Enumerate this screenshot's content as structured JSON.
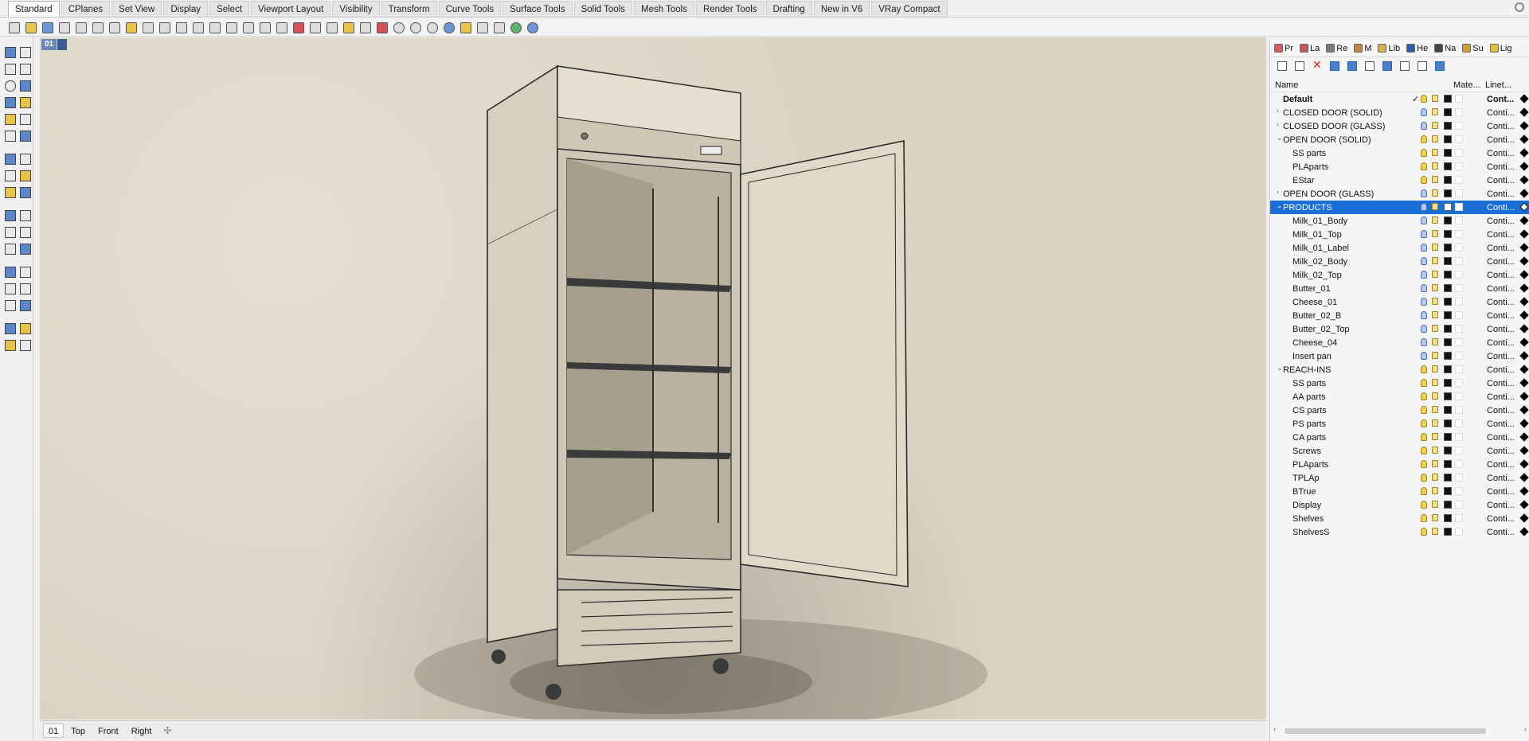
{
  "ribbon_tabs": [
    "Standard",
    "CPlanes",
    "Set View",
    "Display",
    "Select",
    "Viewport Layout",
    "Visibility",
    "Transform",
    "Curve Tools",
    "Surface Tools",
    "Solid Tools",
    "Mesh Tools",
    "Render Tools",
    "Drafting",
    "New in V6",
    "VRay Compact"
  ],
  "active_tab": "Standard",
  "viewport": {
    "name": "01",
    "tabs": [
      "01",
      "Top",
      "Front",
      "Right"
    ],
    "active_tab": "01",
    "add_tab_glyph": "✣"
  },
  "panel": {
    "tabs": [
      {
        "label": "Pr",
        "icon": "properties-icon",
        "color": "#d95b5b"
      },
      {
        "label": "La",
        "icon": "layers-icon",
        "color": "#c65a5a"
      },
      {
        "label": "Re",
        "icon": "render-icon",
        "color": "#7a7a7a"
      },
      {
        "label": "M",
        "icon": "material-icon",
        "color": "#c9873c"
      },
      {
        "label": "Lib",
        "icon": "library-icon",
        "color": "#d6b14a"
      },
      {
        "label": "He",
        "icon": "help-icon",
        "color": "#2b5fa9"
      },
      {
        "label": "Na",
        "icon": "named-views-icon",
        "color": "#444444"
      },
      {
        "label": "Su",
        "icon": "sun-icon",
        "color": "#d6a12e"
      },
      {
        "label": "Lig",
        "icon": "lights-icon",
        "color": "#e0c040"
      }
    ],
    "columns": {
      "name": "Name",
      "material": "Mate...",
      "linetype": "Linet..."
    },
    "selected_color": "#1a6fd6",
    "layers": [
      {
        "name": "Default",
        "level": 0,
        "expander": "",
        "current": true,
        "bulb": "yellow",
        "bold": true,
        "linetype": "Cont..."
      },
      {
        "name": "CLOSED DOOR (SOLID)",
        "level": 0,
        "expander": "›",
        "bulb": "blue",
        "linetype": "Conti..."
      },
      {
        "name": "CLOSED DOOR (GLASS)",
        "level": 0,
        "expander": "›",
        "bulb": "blue",
        "linetype": "Conti..."
      },
      {
        "name": "OPEN DOOR (SOLID)",
        "level": 0,
        "expander": "⌄",
        "bulb": "yellow",
        "linetype": "Conti..."
      },
      {
        "name": "SS parts",
        "level": 1,
        "bulb": "yellow",
        "linetype": "Conti..."
      },
      {
        "name": "PLAparts",
        "level": 1,
        "bulb": "yellow",
        "linetype": "Conti..."
      },
      {
        "name": "EStar",
        "level": 1,
        "bulb": "yellow",
        "linetype": "Conti..."
      },
      {
        "name": "OPEN DOOR (GLASS)",
        "level": 0,
        "expander": "›",
        "bulb": "blue",
        "linetype": "Conti..."
      },
      {
        "name": "PRODUCTS",
        "level": 0,
        "expander": "⌄",
        "bulb": "blue",
        "selected": true,
        "swatch": "white",
        "linetype": "Conti..."
      },
      {
        "name": "Milk_01_Body",
        "level": 1,
        "bulb": "blue",
        "linetype": "Conti..."
      },
      {
        "name": "Milk_01_Top",
        "level": 1,
        "bulb": "blue",
        "linetype": "Conti..."
      },
      {
        "name": "Milk_01_Label",
        "level": 1,
        "bulb": "blue",
        "linetype": "Conti..."
      },
      {
        "name": "Milk_02_Body",
        "level": 1,
        "bulb": "blue",
        "linetype": "Conti..."
      },
      {
        "name": "Milk_02_Top",
        "level": 1,
        "bulb": "blue",
        "linetype": "Conti..."
      },
      {
        "name": "Butter_01",
        "level": 1,
        "bulb": "blue",
        "linetype": "Conti..."
      },
      {
        "name": "Cheese_01",
        "level": 1,
        "bulb": "blue",
        "linetype": "Conti..."
      },
      {
        "name": "Butter_02_B",
        "level": 1,
        "bulb": "blue",
        "linetype": "Conti..."
      },
      {
        "name": "Butter_02_Top",
        "level": 1,
        "bulb": "blue",
        "linetype": "Conti..."
      },
      {
        "name": "Cheese_04",
        "level": 1,
        "bulb": "blue",
        "linetype": "Conti..."
      },
      {
        "name": "Insert pan",
        "level": 1,
        "bulb": "blue",
        "linetype": "Conti..."
      },
      {
        "name": "REACH-INS",
        "level": 0,
        "expander": "⌄",
        "bulb": "yellow",
        "linetype": "Conti..."
      },
      {
        "name": "SS parts",
        "level": 1,
        "bulb": "yellow",
        "linetype": "Conti..."
      },
      {
        "name": "AA parts",
        "level": 1,
        "bulb": "yellow",
        "linetype": "Conti..."
      },
      {
        "name": "CS parts",
        "level": 1,
        "bulb": "yellow",
        "linetype": "Conti..."
      },
      {
        "name": "PS parts",
        "level": 1,
        "bulb": "yellow",
        "linetype": "Conti..."
      },
      {
        "name": "CA parts",
        "level": 1,
        "bulb": "yellow",
        "linetype": "Conti..."
      },
      {
        "name": "Screws",
        "level": 1,
        "bulb": "yellow",
        "linetype": "Conti..."
      },
      {
        "name": "PLAparts",
        "level": 1,
        "bulb": "yellow",
        "linetype": "Conti..."
      },
      {
        "name": "TPLAp",
        "level": 1,
        "bulb": "yellow",
        "linetype": "Conti..."
      },
      {
        "name": "BTrue",
        "level": 1,
        "bulb": "yellow",
        "linetype": "Conti..."
      },
      {
        "name": "Display",
        "level": 1,
        "bulb": "yellow",
        "linetype": "Conti..."
      },
      {
        "name": "Shelves",
        "level": 1,
        "bulb": "yellow",
        "linetype": "Conti..."
      },
      {
        "name": "ShelvesS",
        "level": 1,
        "bulb": "yellow",
        "linetype": "Conti..."
      }
    ]
  }
}
